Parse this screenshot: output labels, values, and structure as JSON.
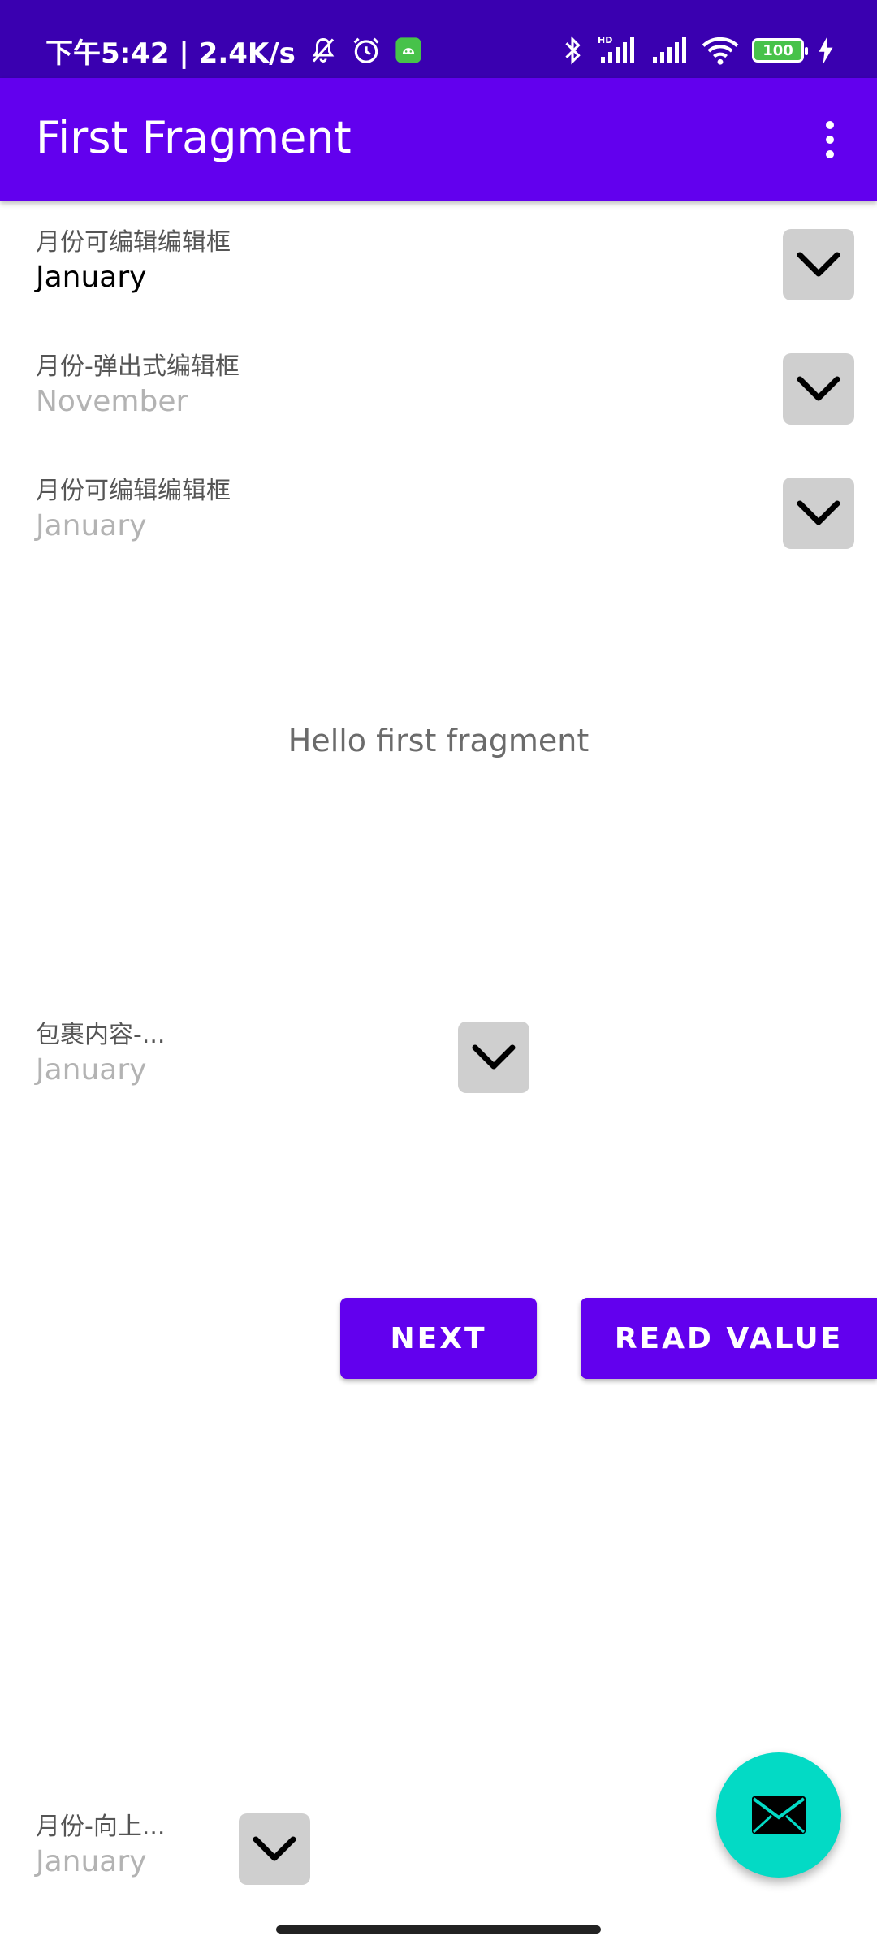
{
  "status_bar": {
    "time_speed": "下午5:42 | 2.4K/s",
    "battery_level": "100",
    "icons": [
      "mute-bell-icon",
      "alarm-icon",
      "android-notification-icon",
      "bluetooth-icon",
      "hd-signal-icon",
      "signal-icon",
      "wifi-icon",
      "battery-icon",
      "charging-icon"
    ]
  },
  "app_bar": {
    "title": "First Fragment",
    "menu_icon": "overflow-menu-icon"
  },
  "fields": [
    {
      "label": "月份可编辑编辑框",
      "value": "January",
      "is_hint": false
    },
    {
      "label": "月份-弹出式编辑框",
      "value": "November",
      "is_hint": true
    },
    {
      "label": "月份可编辑编辑框",
      "value": "January",
      "is_hint": true
    },
    {
      "label": "包裹内容-...",
      "value": "January",
      "is_hint": true
    },
    {
      "label": "月份-向上...",
      "value": "January",
      "is_hint": true
    }
  ],
  "main": {
    "hello_text": "Hello first fragment"
  },
  "buttons": {
    "next": "NEXT",
    "read_value": "READ VALUE"
  },
  "fab": {
    "icon": "email-icon"
  },
  "colors": {
    "status_bar": "#3a00b0",
    "app_bar": "#6200ee",
    "button": "#6200ee",
    "fab": "#03dac5",
    "dropdown_button": "#cfcfcf"
  }
}
